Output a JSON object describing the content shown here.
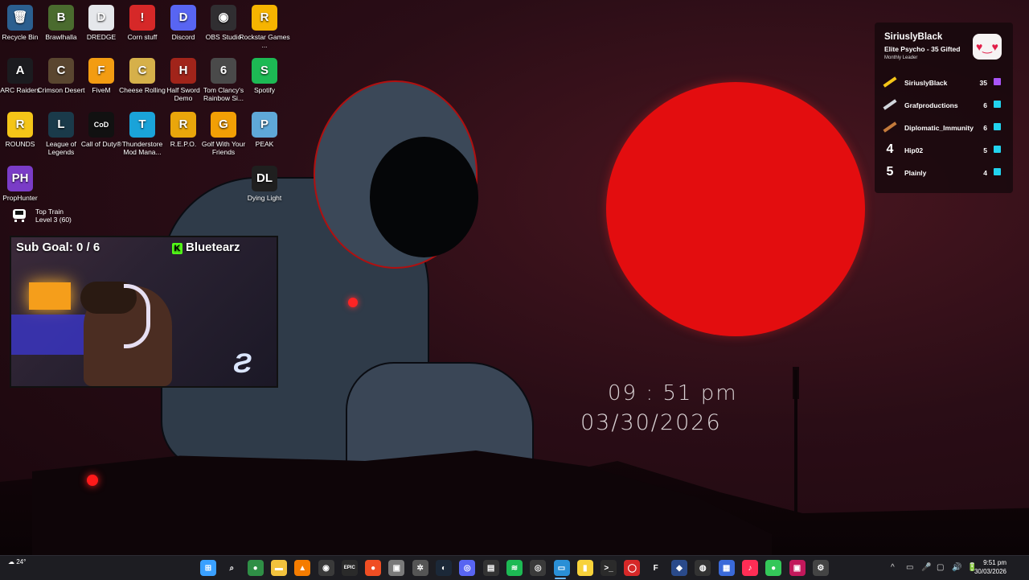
{
  "desktop_icons": [
    {
      "label": "Recycle Bin",
      "glyph": "🗑",
      "color": "#2b5f8f"
    },
    {
      "label": "Brawlhalla",
      "glyph": "B",
      "color": "#4a6b2e"
    },
    {
      "label": "DREDGE",
      "glyph": "D",
      "color": "#e5e7eb"
    },
    {
      "label": "Corn stuff",
      "glyph": "!",
      "color": "#d62828"
    },
    {
      "label": "Discord",
      "glyph": "D",
      "color": "#5865f2"
    },
    {
      "label": "OBS Studio",
      "glyph": "◉",
      "color": "#302e31"
    },
    {
      "label": "Rockstar Games ...",
      "glyph": "R",
      "color": "#f6b400"
    },
    {
      "label": "ARC Raiders",
      "glyph": "A",
      "color": "#1b1b1f"
    },
    {
      "label": "Crimson Desert",
      "glyph": "C",
      "color": "#5a4630"
    },
    {
      "label": "FiveM",
      "glyph": "F",
      "color": "#f39c12"
    },
    {
      "label": "Cheese Rolling",
      "glyph": "C",
      "color": "#d6b04a"
    },
    {
      "label": "Half Sword Demo",
      "glyph": "H",
      "color": "#a1241a"
    },
    {
      "label": "Tom Clancy's Rainbow Si...",
      "glyph": "6",
      "color": "#4a4a4a"
    },
    {
      "label": "Spotify",
      "glyph": "S",
      "color": "#1db954"
    },
    {
      "label": "ROUNDS",
      "glyph": "R",
      "color": "#f5c518"
    },
    {
      "label": "League of Legends",
      "glyph": "L",
      "color": "#1a3a4a"
    },
    {
      "label": "Call of Duty®",
      "glyph": "CoD",
      "color": "#111111"
    },
    {
      "label": "Thunderstore Mod Mana...",
      "glyph": "T",
      "color": "#1aa3d9"
    },
    {
      "label": "R.E.P.O.",
      "glyph": "R",
      "color": "#e9a60b"
    },
    {
      "label": "Golf With Your Friends",
      "glyph": "G",
      "color": "#f29f05"
    },
    {
      "label": "PEAK",
      "glyph": "P",
      "color": "#5fa8d8"
    },
    {
      "label": "PropHunter",
      "glyph": "PH",
      "color": "#7a3cc7"
    },
    {
      "label": "Dying Light",
      "glyph": "DL",
      "color": "#1f1f1f"
    }
  ],
  "top_train": {
    "title": "Top Train",
    "level": "Level 3  (60)"
  },
  "webcam": {
    "sub_goal": "Sub Goal:  0 / 6",
    "channel": "Bluetearz",
    "kick_glyph": "K"
  },
  "wallpaper_clock": {
    "time": "09 : 51  pm",
    "date": "03/30/2026"
  },
  "leaderboard": {
    "leader_name": "SiriuslyBlack",
    "leader_subtitle": "Elite Psycho - 35 Gifted",
    "leader_caption": "Monthly Leader",
    "rows": [
      {
        "rank": "1",
        "user": "SiriuslyBlack",
        "count": "35",
        "accent": "#f5c518",
        "gift_color": "#a855f7"
      },
      {
        "rank": "2",
        "user": "Grafproductions",
        "count": "6",
        "accent": "#d1d5db",
        "gift_color": "#22d3ee"
      },
      {
        "rank": "3",
        "user": "Diplomatic_Immunity",
        "count": "6",
        "accent": "#c47a3b",
        "gift_color": "#22d3ee"
      },
      {
        "rank": "4",
        "user": "Hip02",
        "count": "5",
        "accent": "#ffffff",
        "gift_color": "#22d3ee"
      },
      {
        "rank": "5",
        "user": "Plainly",
        "count": "4",
        "accent": "#ffffff",
        "gift_color": "#22d3ee"
      }
    ]
  },
  "taskbar": {
    "weather": "24°",
    "apps": [
      {
        "name": "start-icon",
        "glyph": "⊞",
        "color": "#3aa0ff"
      },
      {
        "name": "search-icon",
        "glyph": "⌕",
        "color": "transparent"
      },
      {
        "name": "chrome-icon",
        "glyph": "●",
        "color": "#2f8f46"
      },
      {
        "name": "folder-icon",
        "glyph": "▬",
        "color": "#f2c23d"
      },
      {
        "name": "vlc-icon",
        "glyph": "▲",
        "color": "#f57c00"
      },
      {
        "name": "obs-icon",
        "glyph": "◉",
        "color": "#3a3a3a"
      },
      {
        "name": "epic-icon",
        "glyph": "EPIC",
        "color": "#2a2a2a"
      },
      {
        "name": "brave-icon",
        "glyph": "●",
        "color": "#f04e23"
      },
      {
        "name": "app-icon",
        "glyph": "▣",
        "color": "#7a7a7a"
      },
      {
        "name": "settings-wheel-icon",
        "glyph": "✲",
        "color": "#555"
      },
      {
        "name": "steam-icon",
        "glyph": "◐",
        "color": "#1b2838"
      },
      {
        "name": "discord-icon",
        "glyph": "◎",
        "color": "#5865f2"
      },
      {
        "name": "app-icon-2",
        "glyph": "▤",
        "color": "#333"
      },
      {
        "name": "spotify-icon",
        "glyph": "≋",
        "color": "#1db954"
      },
      {
        "name": "xbox-icon",
        "glyph": "◎",
        "color": "#3a3a3a"
      },
      {
        "name": "photos-icon",
        "glyph": "▭",
        "color": "#2a8fd6"
      },
      {
        "name": "sticky-notes-icon",
        "glyph": "▮",
        "color": "#f7d23a"
      },
      {
        "name": "terminal-icon",
        "glyph": ">_",
        "color": "#2b2b2b"
      },
      {
        "name": "app-red-icon",
        "glyph": "◯",
        "color": "#d62828"
      },
      {
        "name": "f-icon",
        "glyph": "F",
        "color": "transparent"
      },
      {
        "name": "app-diamond-icon",
        "glyph": "◆",
        "color": "#2a4a8a"
      },
      {
        "name": "app-dark-icon",
        "glyph": "◍",
        "color": "#333"
      },
      {
        "name": "app-blue-icon",
        "glyph": "▦",
        "color": "#3a6ad9"
      },
      {
        "name": "tiktok-icon",
        "glyph": "♪",
        "color": "#ff2d55"
      },
      {
        "name": "app-green-icon",
        "glyph": "●",
        "color": "#34c759"
      },
      {
        "name": "app-pink-icon",
        "glyph": "▣",
        "color": "#c2185b"
      },
      {
        "name": "settings-icon",
        "glyph": "⚙",
        "color": "#444"
      }
    ],
    "tray": [
      "^",
      "▭",
      "🎤",
      "▢",
      "🔊",
      "🔋"
    ],
    "time": "9:51 pm",
    "date": "30/03/2026"
  }
}
